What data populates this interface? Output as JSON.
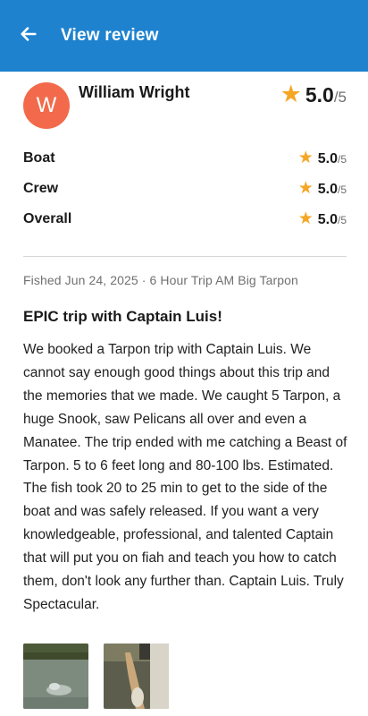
{
  "header": {
    "title": "View review",
    "back_icon": "arrow-left-icon",
    "background": "#1e82cf"
  },
  "reviewer": {
    "initial": "W",
    "name": "William Wright",
    "avatar_color": "#f26a4b",
    "rating": "5.0",
    "rating_max": "/5"
  },
  "ratings": [
    {
      "label": "Boat",
      "value": "5.0",
      "max": "/5"
    },
    {
      "label": "Crew",
      "value": "5.0",
      "max": "/5"
    },
    {
      "label": "Overall",
      "value": "5.0",
      "max": "/5"
    }
  ],
  "meta": "Fished Jun 24, 2025 · 6 Hour Trip AM Big Tarpon",
  "review": {
    "title": "EPIC trip with Captain Luis!",
    "body": "We booked a Tarpon trip with Captain Luis. We cannot say enough good things about this trip and the memories that we made. We caught 5 Tarpon, a huge Snook, saw Pelicans all over and even a Manatee. The trip ended with me catching a Beast of Tarpon. 5 to 6 feet long and 80-100 lbs. Estimated. The fish took 20 to 25 min to get to the side of the boat and was safely released. If you want a very knowledgeable, professional, and talented Captain that will put you on fiah and teach you how to catch them, don't look any further than. Captain Luis. Truly Spectacular."
  },
  "photos": [
    {
      "name": "review-photo-1"
    },
    {
      "name": "review-photo-2"
    }
  ],
  "colors": {
    "star": "#f5a623",
    "accent": "#1e82cf"
  }
}
